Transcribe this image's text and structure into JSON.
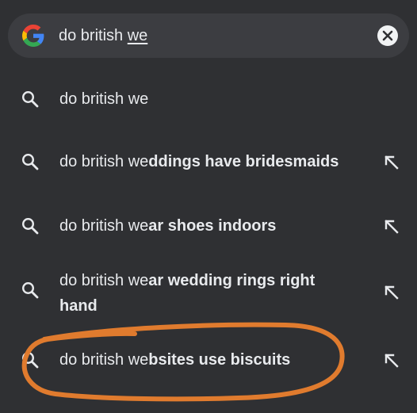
{
  "search": {
    "query_prefix": "do british ",
    "query_underlined": "we"
  },
  "icons": {
    "logo": "google-g-icon",
    "clear": "close-icon",
    "suggestion": "search-icon",
    "fill": "arrow-up-left-icon"
  },
  "suggestions": [
    {
      "typed": "do british we",
      "completion": "",
      "completion_line2": ""
    },
    {
      "typed": "do british we",
      "completion": "ddings have bridesmaids",
      "completion_line2": ""
    },
    {
      "typed": "do british we",
      "completion": "ar shoes indoors",
      "completion_line2": ""
    },
    {
      "typed": "do british we",
      "completion": "ar wedding rings right",
      "completion_line2": "hand"
    },
    {
      "typed": "do british we",
      "completion": "bsites use biscuits",
      "completion_line2": ""
    }
  ],
  "colors": {
    "background": "#2f3033",
    "search_bar": "#3c3d41",
    "text": "#e8eaed",
    "highlight_circle": "#e07b2e"
  }
}
